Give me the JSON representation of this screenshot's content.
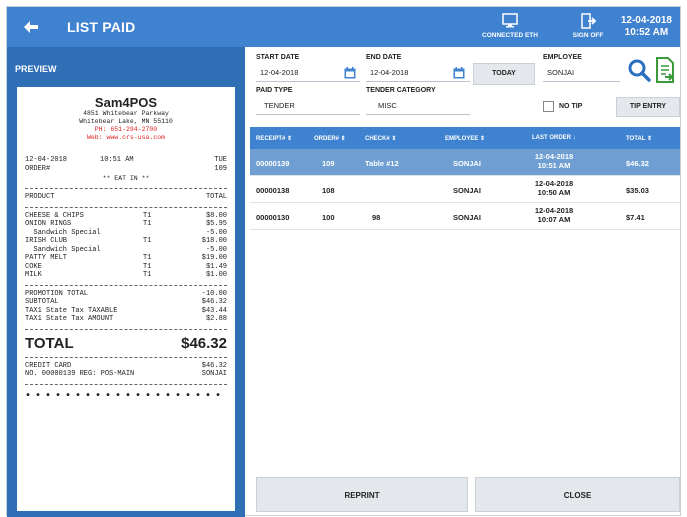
{
  "header": {
    "title": "LIST PAID",
    "eth_label": "CONNECTED ETH",
    "signoff_label": "SIGN OFF",
    "date": "12-04-2018",
    "time": "10:52 AM"
  },
  "preview": {
    "title": "PREVIEW",
    "store": "Sam4POS",
    "address1": "4851 Whitebear Parkway",
    "address2": "Whitebear Lake, MN 55110",
    "phone": "PH: 651-294-2700",
    "web": "Web: www.crs-usa.com",
    "date": "12-04-2018",
    "time": "10:51 AM",
    "day": "TUE",
    "order_label": "ORDER#",
    "order_no": "109",
    "eat_in": "** EAT IN **",
    "product_label": "PRODUCT",
    "total_col_label": "TOTAL",
    "items": [
      {
        "name": "CHEESE & CHIPS",
        "tax": "T1",
        "amount": "$8.00"
      },
      {
        "name": "ONION RINGS",
        "tax": "T1",
        "amount": "$5.95"
      },
      {
        "name": "  Sandwich Special",
        "tax": "",
        "amount": "-5.00"
      },
      {
        "name": "IRISH CLUB",
        "tax": "T1",
        "amount": "$18.00"
      },
      {
        "name": "  Sandwich Special",
        "tax": "",
        "amount": "-5.00"
      },
      {
        "name": "PATTY MELT",
        "tax": "T1",
        "amount": "$19.00"
      },
      {
        "name": "COKE",
        "tax": "T1",
        "amount": "$1.49"
      },
      {
        "name": "MILK",
        "tax": "T1",
        "amount": "$1.00"
      }
    ],
    "summary": [
      {
        "label": "PROMOTION TOTAL",
        "amount": "-10.00"
      },
      {
        "label": "SUBTOTAL",
        "amount": "$46.32"
      },
      {
        "label": "TAX1 State Tax TAXABLE",
        "amount": "$43.44"
      },
      {
        "label": "TAX1 State Tax AMOUNT",
        "amount": "$2.88"
      }
    ],
    "total_label": "TOTAL",
    "total_amount": "$46.32",
    "tender_label": "CREDIT CARD",
    "tender_amount": "$46.32",
    "receipt_line": "NO. 00000139   REG: POS-MAIN",
    "employee": "SONJAI",
    "dots": "••••••••••••••••••••"
  },
  "filters": {
    "start_date_label": "START DATE",
    "start_date": "12-04-2018",
    "end_date_label": "END DATE",
    "end_date": "12-04-2018",
    "today_label": "TODAY",
    "employee_label": "EMPLOYEE",
    "employee": "SONJAI",
    "paid_type_label": "PAID TYPE",
    "paid_type": "TENDER",
    "tender_category_label": "TENDER CATEGORY",
    "tender_category": "MISC",
    "no_tip_label": "NO TIP",
    "tip_entry_label": "TIP ENTRY"
  },
  "table": {
    "columns": [
      "RECEIPT# ⇕",
      "ORDER# ⇕",
      "CHECK# ⇕",
      "EMPLOYEE ⇕",
      "LAST ORDER ↓",
      "TOTAL ⇕"
    ],
    "rows": [
      {
        "receipt": "00000139",
        "order": "109",
        "check": "Table #12",
        "employee": "SONJAI",
        "date": "12-04-2018",
        "time": "10:51 AM",
        "total": "$46.32"
      },
      {
        "receipt": "00000138",
        "order": "108",
        "check": "",
        "employee": "SONJAI",
        "date": "12-04-2018",
        "time": "10:50 AM",
        "total": "$35.03"
      },
      {
        "receipt": "00000130",
        "order": "100",
        "check": "98",
        "employee": "SONJAI",
        "date": "12-04-2018",
        "time": "10:07 AM",
        "total": "$7.41"
      }
    ]
  },
  "footer": {
    "reprint_label": "REPRINT",
    "close_label": "CLOSE"
  },
  "colors": {
    "header_blue": "#3f82cf",
    "preview_blue": "#2e6fb6",
    "selected_row": "#6f9fd2",
    "search_icon": "#2a6fc1",
    "export_icon": "#3a9a3a"
  }
}
